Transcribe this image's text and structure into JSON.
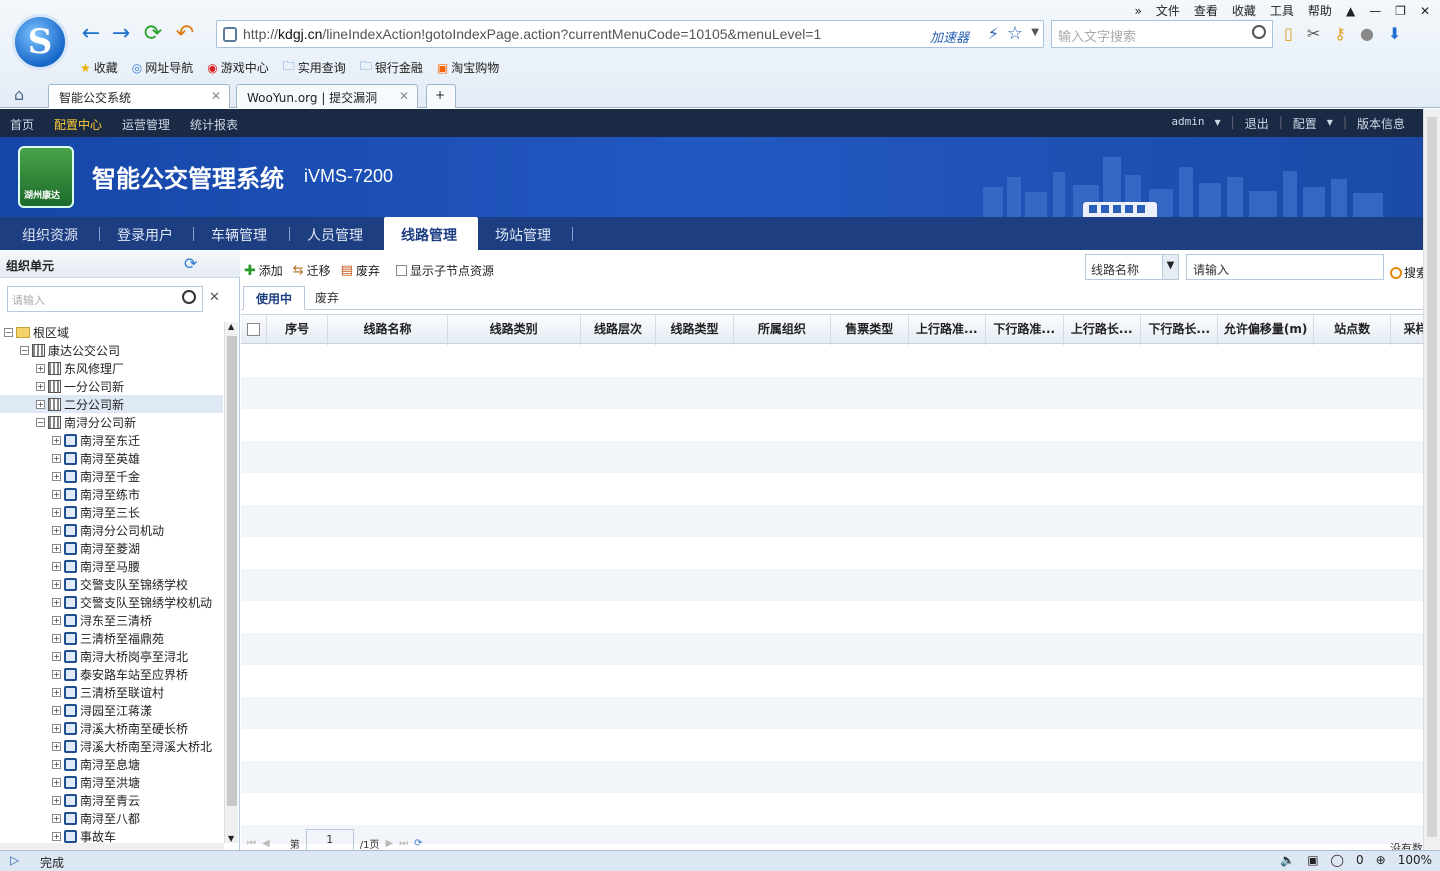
{
  "browser": {
    "menu": [
      "文件",
      "查看",
      "收藏",
      "工具",
      "帮助"
    ],
    "url_prefix": "http://",
    "url_host": "kdgj.cn",
    "url_path": "/lineIndexAction!gotoIndexPage.action?currentMenuCode=10105&menuLevel=1",
    "accelerator": "加速器",
    "search_placeholder": "输入文字搜索",
    "bookmarks": [
      "收藏",
      "网址导航",
      "游戏中心",
      "实用查询",
      "银行金融",
      "淘宝购物"
    ],
    "tabs": [
      {
        "label": "智能公交系统"
      },
      {
        "label": "WooYun.org | 提交漏洞"
      }
    ],
    "new_tab": "+"
  },
  "topnav": {
    "items": [
      "首页",
      "配置中心",
      "运营管理",
      "统计报表"
    ],
    "user": "admin",
    "right": [
      "退出",
      "配置",
      "版本信息"
    ]
  },
  "banner": {
    "title": "智能公交管理系统",
    "model": "iVMS-7200",
    "emblem_text": "湖州康达"
  },
  "module_tabs": [
    "组织资源",
    "登录用户",
    "车辆管理",
    "人员管理",
    "线路管理",
    "场站管理"
  ],
  "left_panel": {
    "title": "组织单元",
    "search_placeholder": "请输入",
    "tree": [
      {
        "label": "根区域",
        "level": 0,
        "icon": "folder"
      },
      {
        "label": "康达公交公司",
        "level": 1,
        "icon": "building"
      },
      {
        "label": "东风修理厂",
        "level": 2,
        "icon": "building"
      },
      {
        "label": "一分公司新",
        "level": 2,
        "icon": "building"
      },
      {
        "label": "二分公司新",
        "level": 2,
        "icon": "building",
        "selected": true
      },
      {
        "label": "南浔分公司新",
        "level": 2,
        "icon": "building"
      },
      {
        "label": "南浔至东迁",
        "level": 3,
        "icon": "bus"
      },
      {
        "label": "南浔至英雄",
        "level": 3,
        "icon": "bus"
      },
      {
        "label": "南浔至千金",
        "level": 3,
        "icon": "bus"
      },
      {
        "label": "南浔至练市",
        "level": 3,
        "icon": "bus"
      },
      {
        "label": "南浔至三长",
        "level": 3,
        "icon": "bus"
      },
      {
        "label": "南浔分公司机动",
        "level": 3,
        "icon": "bus"
      },
      {
        "label": "南浔至菱湖",
        "level": 3,
        "icon": "bus"
      },
      {
        "label": "南浔至马腰",
        "level": 3,
        "icon": "bus"
      },
      {
        "label": "交警支队至锦绣学校",
        "level": 3,
        "icon": "bus"
      },
      {
        "label": "交警支队至锦绣学校机动",
        "level": 3,
        "icon": "bus"
      },
      {
        "label": "浔东至三清桥",
        "level": 3,
        "icon": "bus"
      },
      {
        "label": "三清桥至福鼎苑",
        "level": 3,
        "icon": "bus"
      },
      {
        "label": "南浔大桥岗亭至浔北",
        "level": 3,
        "icon": "bus"
      },
      {
        "label": "泰安路车站至应界桥",
        "level": 3,
        "icon": "bus"
      },
      {
        "label": "三清桥至联谊村",
        "level": 3,
        "icon": "bus"
      },
      {
        "label": "浔园至江蒋漾",
        "level": 3,
        "icon": "bus"
      },
      {
        "label": "浔溪大桥南至硬长桥",
        "level": 3,
        "icon": "bus"
      },
      {
        "label": "浔溪大桥南至浔溪大桥北",
        "level": 3,
        "icon": "bus"
      },
      {
        "label": "南浔至息塘",
        "level": 3,
        "icon": "bus"
      },
      {
        "label": "南浔至洪塘",
        "level": 3,
        "icon": "bus"
      },
      {
        "label": "南浔至青云",
        "level": 3,
        "icon": "bus"
      },
      {
        "label": "南浔至八都",
        "level": 3,
        "icon": "bus"
      },
      {
        "label": "事故车",
        "level": 3,
        "icon": "bus"
      }
    ]
  },
  "toolbar": {
    "add": "添加",
    "migrate": "迁移",
    "discard": "废弃",
    "show_child": "显示子节点资源",
    "filter_field": "线路名称",
    "query_placeholder": "请输入",
    "search": "搜索"
  },
  "sub_tabs": [
    "使用中",
    "废弃"
  ],
  "table": {
    "columns": [
      {
        "label": "序号",
        "w": 62
      },
      {
        "label": "线路名称",
        "w": 120
      },
      {
        "label": "线路类别",
        "w": 134
      },
      {
        "label": "线路层次",
        "w": 76
      },
      {
        "label": "线路类型",
        "w": 78
      },
      {
        "label": "所属组织",
        "w": 98
      },
      {
        "label": "售票类型",
        "w": 78
      },
      {
        "label": "上行路准...",
        "w": 78
      },
      {
        "label": "下行路准...",
        "w": 78
      },
      {
        "label": "上行路长...",
        "w": 78
      },
      {
        "label": "下行路长...",
        "w": 78
      },
      {
        "label": "允许偏移量(m)",
        "w": 96
      },
      {
        "label": "站点数",
        "w": 78
      },
      {
        "label": "采样",
        "w": 50
      }
    ],
    "rows": []
  },
  "pager": {
    "page_prefix": "第",
    "page_value": "1",
    "page_total": "/1页",
    "empty_text": "没有数"
  },
  "status": {
    "text": "完成",
    "count": "0",
    "zoom": "100%"
  }
}
